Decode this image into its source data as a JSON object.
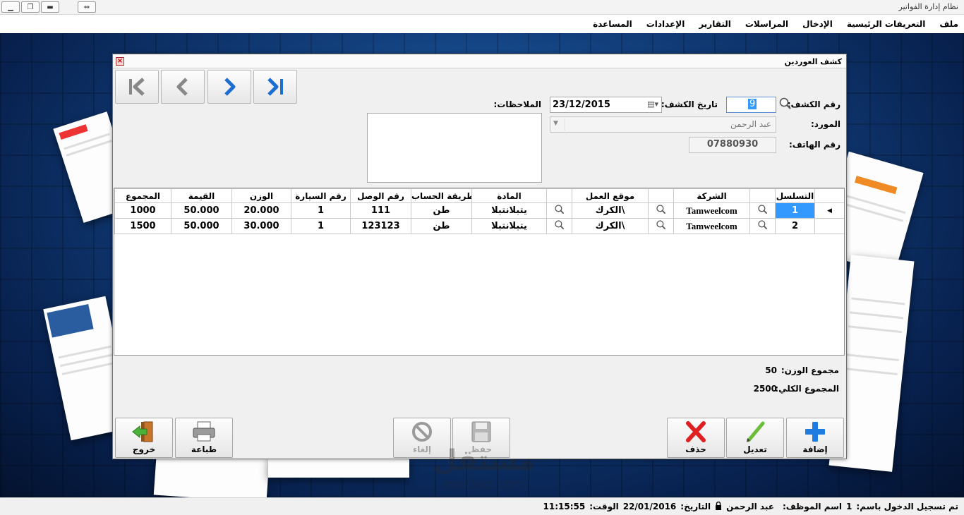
{
  "window": {
    "title": "نظام إدارة الفواتير"
  },
  "menu": [
    "ملف",
    "التعريفات الرئيسية",
    "الإدخال",
    "المراسلات",
    "التقارير",
    "الإعدادات",
    "المساعدة"
  ],
  "dialog": {
    "title": "كشف العوردين",
    "labels": {
      "statement_no": "رقم الكشف:",
      "statement_date": "تاريخ الكشف:",
      "supplier": "المورد:",
      "phone": "رقم الهاتف:",
      "notes": "الملاحظات:"
    },
    "statement_no": "9",
    "statement_date": "23/12/2015",
    "supplier": "عبد الرحمن",
    "phone": "07880930",
    "notes": ""
  },
  "grid": {
    "columns": [
      "التسلسل",
      "",
      "الشركة",
      "",
      "موقع العمل",
      "",
      "المادة",
      "طريقة الحساب",
      "رقم الوصل",
      "رقم السيارة",
      "الوزن",
      "القيمة",
      "المجموع"
    ],
    "rows": [
      {
        "seq": "1",
        "company": "Tamweelcom",
        "site": "الكرك\\",
        "material": "يتبلانتبلا",
        "calc": "طن",
        "receipt": "111",
        "car": "1",
        "weight": "20.000",
        "value": "50.000",
        "total": "1000"
      },
      {
        "seq": "2",
        "company": "Tamweelcom",
        "site": "الكرك\\",
        "material": "يتبلانتبلا",
        "calc": "طن",
        "receipt": "123123",
        "car": "1",
        "weight": "30.000",
        "value": "50.000",
        "total": "1500"
      }
    ]
  },
  "totals": {
    "weight_label": "مجموع الوزن:",
    "weight": "50",
    "total_label": "المجموع الكلي:",
    "total": "2500"
  },
  "buttons": {
    "add": "إضافة",
    "edit": "تعديل",
    "delete": "حذف",
    "save": "حفظ",
    "cancel": "إلغاء",
    "print": "طباعة",
    "exit": "خروج"
  },
  "watermark": {
    "ar": "مستقل",
    "en": "mostaql.com"
  },
  "status": {
    "login_label": "تم تسجيل الدخول باسم:",
    "login_value": "1",
    "employee_label": "اسم الموظف:",
    "employee_value": "عبد الرحمن",
    "date_label": "التاريخ:",
    "date_value": "22/01/2016",
    "time_label": "الوقت:",
    "time_value": "11:15:55"
  },
  "colors": {
    "selection": "#3399ff",
    "add_icon": "#1e7be0",
    "delete_icon": "#e02020",
    "edit_icon": "#6cbe3a"
  },
  "icons": [
    "first-record-icon",
    "previous-record-icon",
    "next-record-icon",
    "last-record-icon",
    "search-icon",
    "calendar-icon",
    "exit-door-icon",
    "printer-icon",
    "cancel-icon",
    "save-disk-icon",
    "delete-x-icon",
    "edit-pencil-icon",
    "add-plus-icon",
    "lock-icon"
  ]
}
